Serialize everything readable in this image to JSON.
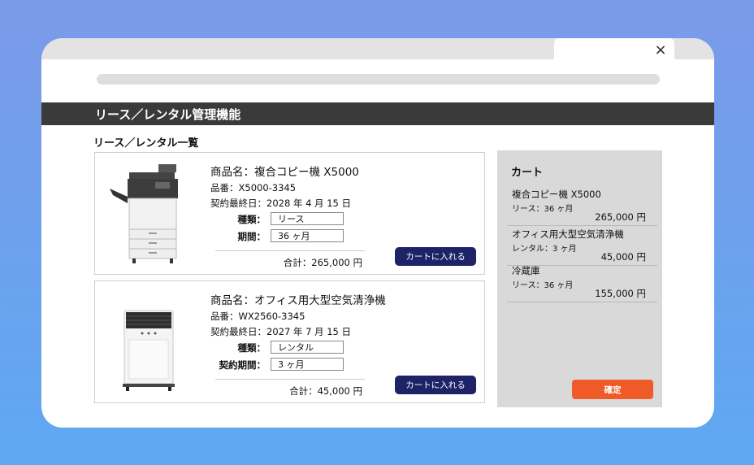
{
  "app": {
    "title": "リース／レンタル管理機能",
    "close_glyph": "×"
  },
  "list": {
    "heading": "リース／レンタル一覧",
    "products": [
      {
        "name": "商品名：複合コピー機 X5000",
        "number": "品番：X5000-3345",
        "last_date": "契約最終日：2028 年 4 月 15 日",
        "type_label": "種類：",
        "type_value": "リース",
        "period_label": "期間：",
        "period_value": "36 ヶ月",
        "total": "合計：265,000 円",
        "cart_button": "カートに入れる",
        "image_icon": "copier-icon"
      },
      {
        "name": "商品名：オフィス用大型空気清浄機",
        "number": "品番：WX2560-3345",
        "last_date": "契約最終日：2027 年 7 月 15 日",
        "type_label": "種類：",
        "type_value": "レンタル",
        "period_label": "契約期間：",
        "period_value": "3 ヶ月",
        "total": "合計：45,000 円",
        "cart_button": "カートに入れる",
        "image_icon": "air-purifier-icon"
      }
    ]
  },
  "cart": {
    "title": "カート",
    "items": [
      {
        "name": "複合コピー機 X5000",
        "term": "リース：36 ヶ月",
        "price": "265,000 円"
      },
      {
        "name": "オフィス用大型空気清浄機",
        "term": "レンタル：3 ヶ月",
        "price": "45,000 円"
      },
      {
        "name": "冷蔵庫",
        "term": "リース：36 ヶ月",
        "price": "155,000 円"
      }
    ],
    "confirm_button": "確定"
  },
  "colors": {
    "title_bar": "#3a3a3a",
    "cart_button": "#1d2366",
    "confirm_button": "#f05a28",
    "cart_panel": "#d9d9d9"
  }
}
